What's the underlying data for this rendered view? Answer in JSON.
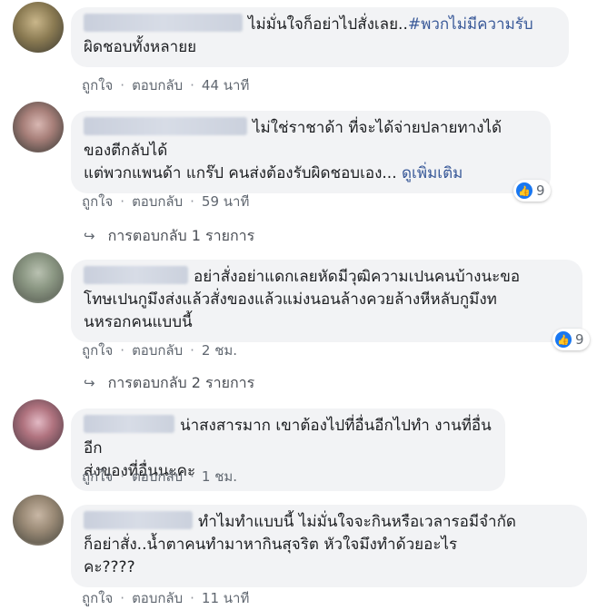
{
  "comments": [
    {
      "text": "ไม่มั่นใจก็อย่าไปสั่งเลย..",
      "hashtag": "#พวกไม่มีความรับ",
      "text2": "ผิดชอบทั้งหลายย",
      "actions": {
        "like": "ถูกใจ",
        "reply": "ตอบกลับ",
        "time": "44 นาที"
      }
    },
    {
      "text": "ไม่ใช่ราชาด้า ที่จะได้จ่ายปลายทางได้",
      "text2": "ของตีกลับได้",
      "text3": "แต่พวกแพนด้า แกร๊ป คนส่งต้องรับผิดชอบเอง...",
      "more": "ดูเพิ่มเติม",
      "actions": {
        "like": "ถูกใจ",
        "reply": "ตอบกลับ",
        "time": "59 นาที"
      },
      "reaction_count": "9",
      "replies": "การตอบกลับ 1 รายการ"
    },
    {
      "text": "อย่าสั่งอย่าแดกเลยหัดมีวุฒิความเปนคนบ้างนะขอ",
      "text2": "โทษเปนกูมึงส่งแล้วสั่งของแล้วแม่งนอนล้างควยล้างหีหลับกูมึงท",
      "text3": "นหรอกคนแบบนี้",
      "actions": {
        "like": "ถูกใจ",
        "reply": "ตอบกลับ",
        "time": "2 ชม."
      },
      "reaction_count": "9",
      "replies": "การตอบกลับ 2 รายการ"
    },
    {
      "text": "น่าสงสารมาก เขาต้องไปที่อื่นอีกไปทำ งานที่อื่นอีก",
      "text2": "ส่งของที่อื่นนะคะ",
      "actions": {
        "like": "ถูกใจ",
        "reply": "ตอบกลับ",
        "time": "1 ชม."
      }
    },
    {
      "text": "ทำไมทำแบบนี้ ไม่มั่นใจจะกินหรือเวลารอมีจำกัด",
      "text2": "ก็อย่าสั่ง..น้ำตาคนทำมาหากินสุจริต หัวใจมึงทำด้วยอะไร",
      "text3": "คะ????",
      "actions": {
        "like": "ถูกใจ",
        "reply": "ตอบกลับ",
        "time": "11 นาที"
      }
    }
  ],
  "icons": {
    "like": "thumbs-up-icon",
    "reply_arrow": "reply-arrow-icon"
  },
  "colors": {
    "link": "#385898",
    "bubble": "#f2f3f5",
    "like_blue": "#1877f2"
  }
}
